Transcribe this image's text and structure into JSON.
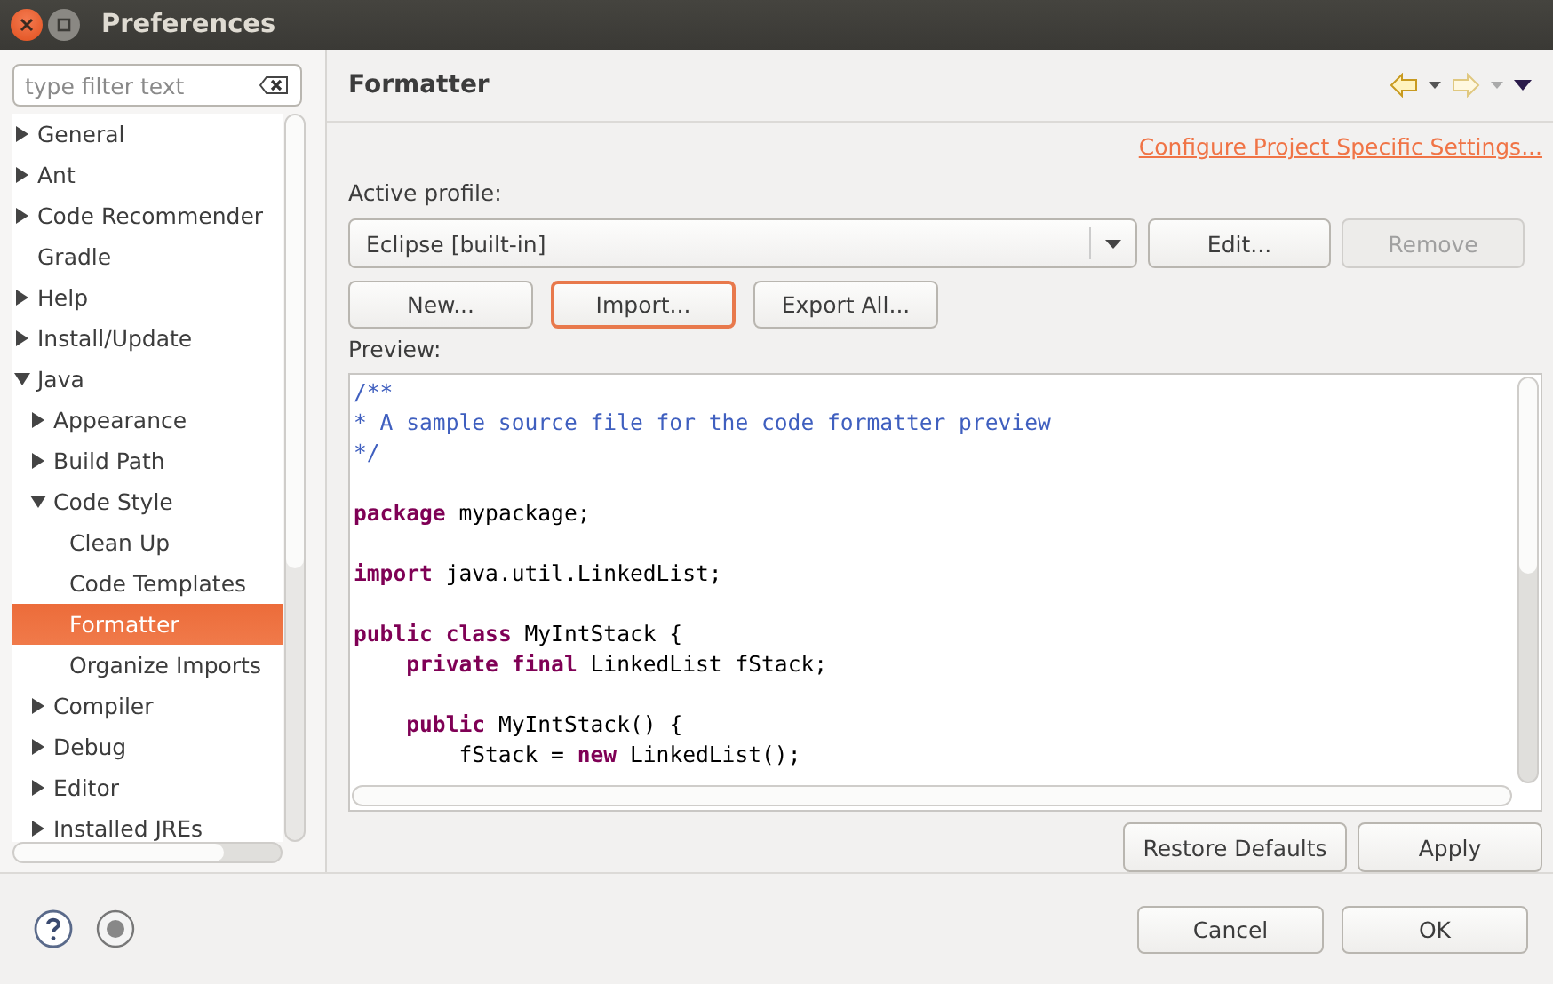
{
  "window": {
    "title": "Preferences"
  },
  "filter": {
    "placeholder": "type filter text"
  },
  "tree": [
    {
      "label": "General",
      "kind": "branch",
      "expanded": false,
      "selected": false
    },
    {
      "label": "Ant",
      "kind": "branch",
      "expanded": false,
      "selected": false
    },
    {
      "label": "Code Recommender",
      "kind": "branch",
      "expanded": false,
      "selected": false
    },
    {
      "label": "Gradle",
      "kind": "leaf",
      "selected": false
    },
    {
      "label": "Help",
      "kind": "branch",
      "expanded": false,
      "selected": false
    },
    {
      "label": "Install/Update",
      "kind": "branch",
      "expanded": false,
      "selected": false
    },
    {
      "label": "Java",
      "kind": "branch",
      "expanded": true,
      "selected": false,
      "children": [
        {
          "label": "Appearance",
          "kind": "branch",
          "expanded": false,
          "selected": false
        },
        {
          "label": "Build Path",
          "kind": "branch",
          "expanded": false,
          "selected": false
        },
        {
          "label": "Code Style",
          "kind": "branch",
          "expanded": true,
          "selected": false,
          "children": [
            {
              "label": "Clean Up",
              "kind": "leaf",
              "selected": false
            },
            {
              "label": "Code Templates",
              "kind": "leaf",
              "selected": false
            },
            {
              "label": "Formatter",
              "kind": "leaf",
              "selected": true
            },
            {
              "label": "Organize Imports",
              "kind": "leaf",
              "selected": false
            }
          ]
        },
        {
          "label": "Compiler",
          "kind": "branch",
          "expanded": false,
          "selected": false
        },
        {
          "label": "Debug",
          "kind": "branch",
          "expanded": false,
          "selected": false
        },
        {
          "label": "Editor",
          "kind": "branch",
          "expanded": false,
          "selected": false
        },
        {
          "label": "Installed JREs",
          "kind": "branch",
          "expanded": false,
          "selected": false
        }
      ]
    }
  ],
  "page": {
    "title": "Formatter",
    "link": "Configure Project Specific Settings...",
    "profile_label": "Active profile:",
    "profile_value": "Eclipse [built-in]",
    "profile_buttons": [
      {
        "label": "Edit...",
        "disabled": false
      },
      {
        "label": "Remove",
        "disabled": true
      }
    ],
    "action_buttons": [
      {
        "label": "New...",
        "focused": false
      },
      {
        "label": "Import...",
        "focused": true
      },
      {
        "label": "Export All...",
        "focused": false
      }
    ],
    "preview_label": "Preview:",
    "code": [
      {
        "kind": "text",
        "segments": [
          {
            "kind": "comment",
            "text": "/**"
          }
        ]
      },
      {
        "kind": "text",
        "segments": [
          {
            "kind": "comment",
            "text": "* A sample source file for the code formatter preview"
          }
        ]
      },
      {
        "kind": "text",
        "segments": [
          {
            "kind": "comment",
            "text": "*/"
          }
        ]
      },
      {
        "kind": "blank"
      },
      {
        "kind": "text",
        "segments": [
          {
            "kind": "keyword",
            "text": "package"
          },
          {
            "kind": "plain",
            "text": " mypackage;"
          }
        ]
      },
      {
        "kind": "blank"
      },
      {
        "kind": "text",
        "segments": [
          {
            "kind": "keyword",
            "text": "import"
          },
          {
            "kind": "plain",
            "text": " java.util.LinkedList;"
          }
        ]
      },
      {
        "kind": "blank"
      },
      {
        "kind": "text",
        "segments": [
          {
            "kind": "keyword",
            "text": "public"
          },
          {
            "kind": "keyword",
            "text": " class"
          },
          {
            "kind": "plain",
            "text": " MyIntStack {"
          }
        ]
      },
      {
        "kind": "text",
        "segments": [
          {
            "kind": "keyword",
            "text": "    private"
          },
          {
            "kind": "keyword",
            "text": " final"
          },
          {
            "kind": "plain",
            "text": " LinkedList fStack;"
          }
        ]
      },
      {
        "kind": "blank"
      },
      {
        "kind": "text",
        "segments": [
          {
            "kind": "keyword",
            "text": "    public"
          },
          {
            "kind": "plain",
            "text": " MyIntStack() {"
          }
        ]
      },
      {
        "kind": "text",
        "segments": [
          {
            "kind": "plain",
            "text": "        fStack = "
          },
          {
            "kind": "keyword",
            "text": "new"
          },
          {
            "kind": "plain",
            "text": " LinkedList();"
          }
        ]
      }
    ],
    "page_buttons": [
      "Restore Defaults",
      "Apply"
    ]
  },
  "dialog_buttons": [
    "Cancel",
    "OK"
  ]
}
